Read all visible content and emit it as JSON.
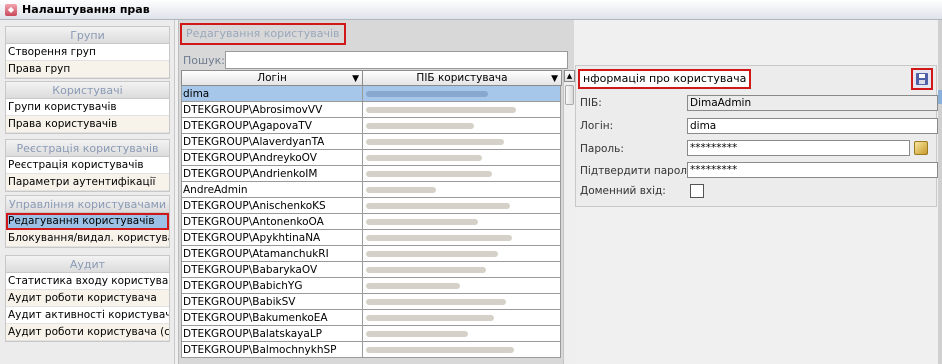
{
  "window": {
    "title": "Налаштування прав"
  },
  "nav": {
    "groups": [
      {
        "title": "Групи",
        "items": [
          "Створення груп",
          "Права груп"
        ]
      },
      {
        "title": "Користувачі",
        "items": [
          "Групи користувачів",
          "Права користувачів"
        ]
      },
      {
        "title": "Реєстрація користувачів",
        "items": [
          "Реєстрація користувачів",
          "Параметри аутентифікації"
        ]
      },
      {
        "title": "Управління користувачами",
        "items": [
          "Редагування користувачів",
          "Блокування/видал. користувачів"
        ]
      },
      {
        "title": "Аудит",
        "items": [
          "Статистика входу користувачів",
          "Аудит роботи користувача",
          "Аудит активності користувача",
          "Аудит роботи користувача (стари"
        ]
      }
    ],
    "selected": "Редагування користувачів"
  },
  "main": {
    "title": "Редагування користувачів",
    "search": {
      "label": "Пошук:",
      "value": ""
    },
    "grid": {
      "columns": [
        "Логін",
        "ПІБ користувача"
      ],
      "rows": [
        "dima",
        "DTEKGROUP\\AbrosimovVV",
        "DTEKGROUP\\AgapovaTV",
        "DTEKGROUP\\AlaverdyanTA",
        "DTEKGROUP\\AndreykoOV",
        "DTEKGROUP\\AndrienkoIM",
        "AndreAdmin",
        "DTEKGROUP\\AnischenkoKS",
        "DTEKGROUP\\AntonenkoOA",
        "DTEKGROUP\\ApykhtinaNA",
        "DTEKGROUP\\AtamanchukRI",
        "DTEKGROUP\\BabarykaOV",
        "DTEKGROUP\\BabichYG",
        "DTEKGROUP\\BabikSV",
        "DTEKGROUP\\BakumenkoEA",
        "DTEKGROUP\\BalatskayaLP",
        "DTEKGROUP\\BalmochnykhSP"
      ],
      "selected_index": 0
    }
  },
  "details": {
    "title": "нформація про користувача",
    "fields": {
      "pib": {
        "label": "ПІБ:",
        "value": "DimaAdmin"
      },
      "login": {
        "label": "Логін:",
        "value": "dima"
      },
      "password": {
        "label": "Пароль:",
        "value": "*********"
      },
      "confirm": {
        "label": "Підтвердити пароль:",
        "value": "*********"
      },
      "domain": {
        "label": "Доменний вхід:",
        "checked": false
      }
    }
  }
}
